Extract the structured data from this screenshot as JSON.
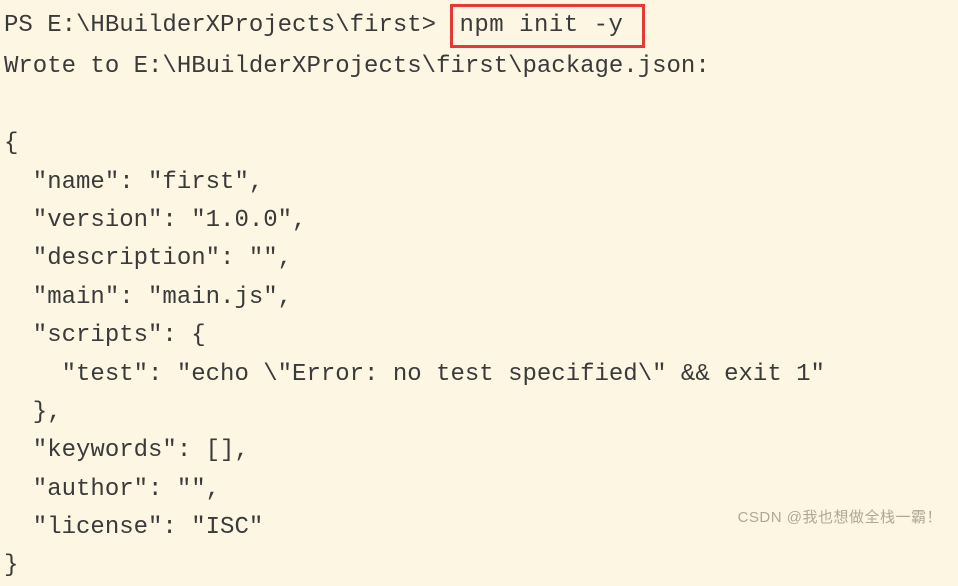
{
  "terminal": {
    "prompt": "PS E:\\HBuilderXProjects\\first> ",
    "command": "npm init -y ",
    "output_line": "Wrote to E:\\HBuilderXProjects\\first\\package.json:",
    "json_output": "{\n  \"name\": \"first\",\n  \"version\": \"1.0.0\",\n  \"description\": \"\",\n  \"main\": \"main.js\",\n  \"scripts\": {\n    \"test\": \"echo \\\"Error: no test specified\\\" && exit 1\"\n  },\n  \"keywords\": [],\n  \"author\": \"\",\n  \"license\": \"ISC\"\n}"
  },
  "watermark": "CSDN @我也想做全栈一霸！"
}
